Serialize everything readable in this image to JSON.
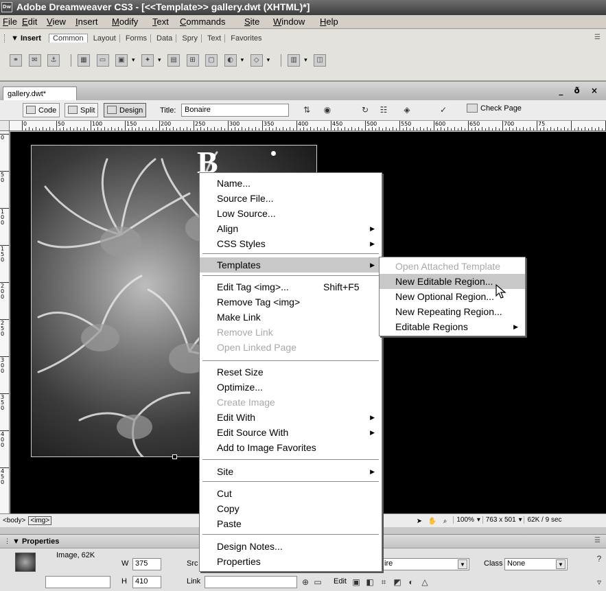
{
  "window": {
    "title": "Adobe Dreamweaver CS3 - [<<Template>> gallery.dwt (XHTML)*]",
    "app_icon": "Dw"
  },
  "menubar": {
    "items": [
      "File",
      "Edit",
      "View",
      "Insert",
      "Modify",
      "Text",
      "Commands",
      "Site",
      "Window",
      "Help"
    ]
  },
  "insert_bar": {
    "label": "▼ Insert",
    "tabs": [
      "Common",
      "Layout",
      "Forms",
      "Data",
      "Spry",
      "Text",
      "Favorites"
    ],
    "active_tab": "Common",
    "icons": [
      "hyperlink-icon",
      "email-link-icon",
      "named-anchor-icon",
      "table-icon",
      "div-icon",
      "images-icon",
      "media-icon",
      "date-icon",
      "server-side-include-icon",
      "comment-icon",
      "head-icon",
      "script-icon",
      "templates-icon",
      "tag-chooser-icon"
    ]
  },
  "document": {
    "tab_label": "gallery.dwt*",
    "window_controls": "_ ð ×",
    "view_buttons": {
      "code": "Code",
      "split": "Split",
      "design": "Design"
    },
    "title_label": "Title:",
    "title_value": "Bonaire",
    "check_page": "Check Page",
    "ruler_marks": [
      "0",
      "50",
      "100",
      "150",
      "200",
      "250",
      "300",
      "350",
      "400",
      "450",
      "500",
      "550",
      "600",
      "650",
      "700",
      "75"
    ],
    "ruler_v_marks": [
      "0",
      "50",
      "100",
      "150",
      "200",
      "250",
      "300",
      "350",
      "400",
      "450"
    ],
    "heading_partial": "B"
  },
  "statusbar": {
    "tags": [
      "<body>",
      "<img>"
    ],
    "zoom": "100%",
    "window_size": "763 x 501",
    "download": "62K / 9 sec"
  },
  "properties": {
    "title": "▼ Properties",
    "type_label": "Image, 62K",
    "w_label": "W",
    "w_value": "375",
    "h_label": "H",
    "h_value": "410",
    "src_label": "Src",
    "link_label": "Link",
    "edit_label": "Edit",
    "alt_value": "ire",
    "class_label": "Class",
    "class_value": "None"
  },
  "context_menu": {
    "items": [
      {
        "label": "Name...",
        "disabled": false
      },
      {
        "label": "Source File...",
        "disabled": false
      },
      {
        "label": "Low Source...",
        "disabled": false
      },
      {
        "label": "Align",
        "submenu": true
      },
      {
        "label": "CSS Styles",
        "submenu": true
      },
      {
        "label": "Templates",
        "submenu": true,
        "highlighted": true
      },
      {
        "label": "Edit Tag <img>...",
        "shortcut": "Shift+F5"
      },
      {
        "label": "Remove Tag <img>"
      },
      {
        "label": "Make Link"
      },
      {
        "label": "Remove Link",
        "disabled": true
      },
      {
        "label": "Open Linked Page",
        "disabled": true
      },
      {
        "label": "Reset Size"
      },
      {
        "label": "Optimize..."
      },
      {
        "label": "Create Image",
        "disabled": true
      },
      {
        "label": "Edit With",
        "submenu": true
      },
      {
        "label": "Edit Source With",
        "submenu": true
      },
      {
        "label": "Add to Image Favorites"
      },
      {
        "label": "Site",
        "submenu": true
      },
      {
        "label": "Cut"
      },
      {
        "label": "Copy"
      },
      {
        "label": "Paste"
      },
      {
        "label": "Design Notes..."
      },
      {
        "label": "Properties"
      }
    ],
    "templates_submenu": [
      {
        "label": "Open Attached Template",
        "disabled": true
      },
      {
        "label": "New Editable Region...",
        "highlighted": true
      },
      {
        "label": "New Optional Region..."
      },
      {
        "label": "New Repeating Region..."
      },
      {
        "label": "Editable Regions",
        "submenu": true
      }
    ]
  }
}
